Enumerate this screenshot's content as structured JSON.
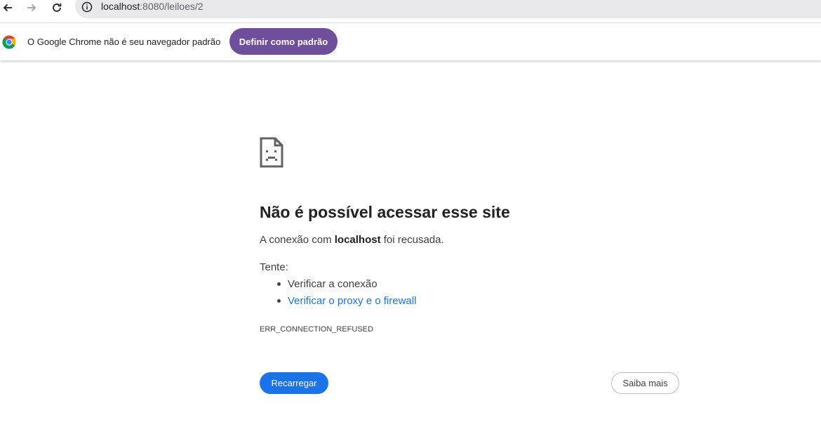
{
  "browser": {
    "url_host": "localhost",
    "url_path": ":8080/leiloes/2",
    "icons": {
      "back": "arrow-left-icon",
      "forward": "arrow-right-icon",
      "reload": "reload-icon",
      "site_info": "info-icon"
    }
  },
  "infobar": {
    "message": "O Google Chrome não é seu navegador padrão",
    "button_label": "Definir como padrão",
    "button_color": "#6f4e9b"
  },
  "error": {
    "icon": "sad-page-icon",
    "title": "Não é possível acessar esse site",
    "desc_prefix": "A conexão com ",
    "desc_host": "localhost",
    "desc_suffix": " foi recusada.",
    "try_label": "Tente:",
    "suggestions": [
      {
        "label": "Verificar a conexão",
        "link": false
      },
      {
        "label": "Verificar o proxy e o firewall",
        "link": true
      }
    ],
    "code": "ERR_CONNECTION_REFUSED",
    "reload_label": "Recarregar",
    "more_label": "Saiba mais",
    "accent_color": "#1a73e8"
  }
}
